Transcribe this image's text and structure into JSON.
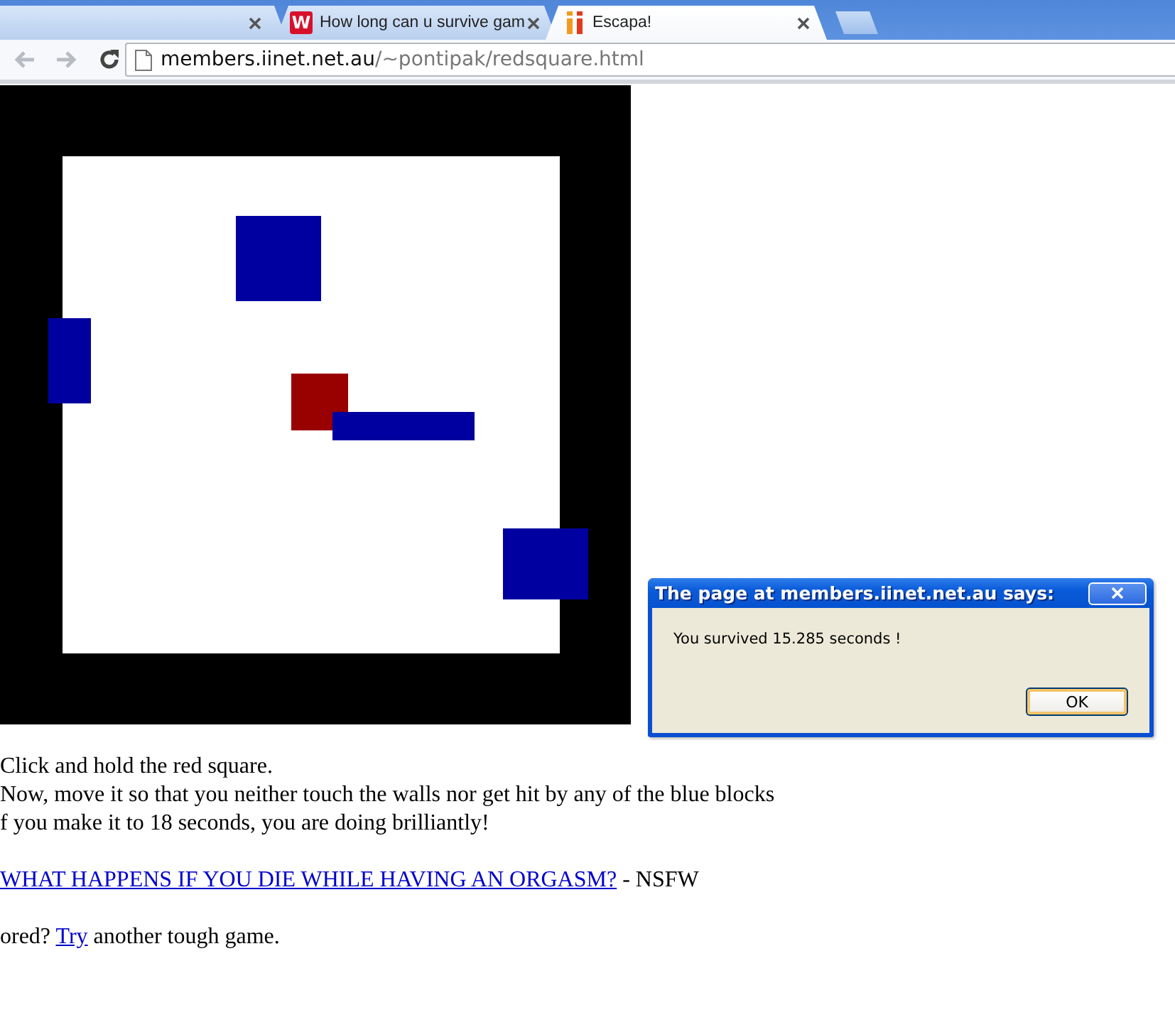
{
  "browser": {
    "tabs": [
      {
        "selected": false
      },
      {
        "favicon_letter": "W",
        "title": "How long can u survive gam",
        "selected": false
      },
      {
        "title": "Escapa!",
        "selected": true
      }
    ],
    "address": {
      "host": "members.iinet.net.au",
      "path": "/~pontipak/redsquare.html"
    }
  },
  "instructions": [
    "Click and hold the red square.",
    "Now, move it so that you neither touch the walls nor get hit by any of the blue blocks",
    "f you make it to 18 seconds, you are doing brilliantly!"
  ],
  "nsfw_line": {
    "link": "WHAT HAPPENS IF YOU DIE WHILE HAVING AN ORGASM?",
    "suffix": "- NSFW"
  },
  "bored_line": {
    "prefix": "ored?",
    "link": "Try",
    "suffix": "another tough game."
  },
  "dialog": {
    "title": "The page at members.iinet.net.au says:",
    "message": "You survived 15.285 seconds !",
    "button": "OK"
  }
}
